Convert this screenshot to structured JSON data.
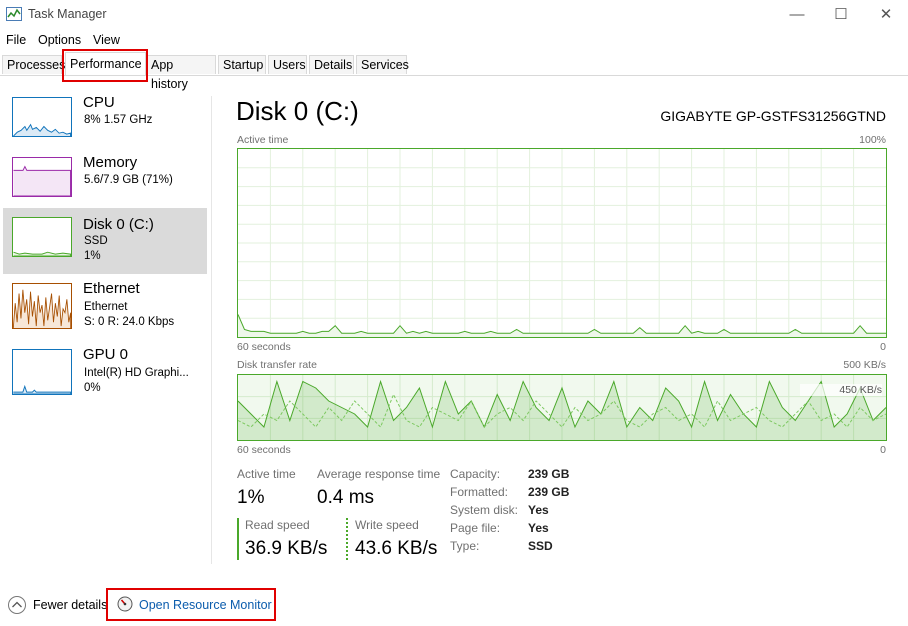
{
  "window": {
    "title": "Task Manager",
    "minimize_glyph": "—",
    "maximize_glyph": "☐",
    "close_glyph": "✕"
  },
  "menu": [
    "File",
    "Options",
    "View"
  ],
  "tabs": [
    {
      "label": "Processes",
      "active": false
    },
    {
      "label": "Performance",
      "active": true
    },
    {
      "label": "App history",
      "active": false
    },
    {
      "label": "Startup",
      "active": false
    },
    {
      "label": "Users",
      "active": false
    },
    {
      "label": "Details",
      "active": false
    },
    {
      "label": "Services",
      "active": false
    }
  ],
  "sidebar": {
    "items": [
      {
        "title": "CPU",
        "line1": "8%  1.57 GHz",
        "line2": "",
        "line3": "",
        "color": "#1174bb"
      },
      {
        "title": "Memory",
        "line1": "5.6/7.9 GB (71%)",
        "line2": "",
        "line3": "",
        "color": "#9a2aa8"
      },
      {
        "title": "Disk 0 (C:)",
        "line1": "SSD",
        "line2": "1%",
        "line3": "",
        "color": "#4aa82a"
      },
      {
        "title": "Ethernet",
        "line1": "Ethernet",
        "line2": "S: 0  R: 24.0 Kbps",
        "line3": "",
        "color": "#a74f01"
      },
      {
        "title": "GPU 0",
        "line1": "Intel(R) HD Graphi...",
        "line2": "0%",
        "line3": "",
        "color": "#1174bb"
      }
    ]
  },
  "main": {
    "title": "Disk 0 (C:)",
    "model": "GIGABYTE GP-GSTFS31256GTND",
    "active_graph": {
      "label": "Active time",
      "max": "100%",
      "time_label": "60 seconds",
      "min": "0",
      "values": [
        12,
        4,
        3,
        3,
        3,
        2,
        2,
        2,
        2,
        2,
        3,
        2,
        2,
        3,
        3,
        6,
        2,
        2,
        2,
        3,
        2,
        2,
        2,
        2,
        2,
        6,
        2,
        3,
        2,
        3,
        2,
        2,
        2,
        2,
        2,
        3,
        2,
        2,
        2,
        3,
        2,
        2,
        2,
        4,
        2,
        2,
        2,
        2,
        2,
        2,
        2,
        2,
        2,
        2,
        2,
        4,
        2,
        2,
        2,
        2,
        2,
        2,
        5,
        2,
        2,
        2,
        2,
        2,
        2,
        6,
        2,
        3,
        2,
        2,
        2,
        4,
        2,
        2,
        2,
        2,
        2,
        2,
        2,
        2,
        2,
        2,
        4,
        2,
        2,
        2,
        2,
        2,
        2,
        2,
        2,
        2,
        6,
        2,
        2,
        2,
        2
      ]
    },
    "transfer_graph": {
      "label": "Disk transfer rate",
      "max": "500 KB/s",
      "inner_max": "450 KB/s",
      "time_label": "60 seconds",
      "min": "0",
      "read_values": [
        60,
        40,
        20,
        90,
        30,
        90,
        80,
        60,
        50,
        40,
        20,
        90,
        30,
        50,
        80,
        20,
        90,
        40,
        60,
        20,
        70,
        30,
        90,
        50,
        30,
        80,
        20,
        60,
        40,
        90,
        20,
        50,
        30,
        80,
        60,
        20,
        90,
        30,
        70,
        40,
        20,
        90,
        50,
        30,
        60,
        90,
        20,
        40,
        80,
        30,
        50
      ],
      "write_values": [
        30,
        20,
        40,
        30,
        60,
        40,
        20,
        50,
        30,
        60,
        40,
        20,
        70,
        30,
        20,
        50,
        40,
        30,
        60,
        20,
        40,
        50,
        30,
        60,
        40,
        20,
        50,
        30,
        40,
        60,
        30,
        20,
        40,
        50,
        30,
        40,
        20,
        60,
        30,
        40,
        50,
        30,
        20,
        40,
        60,
        30,
        40,
        20,
        50,
        30,
        40
      ]
    },
    "stats": {
      "active_time_label": "Active time",
      "active_time_value": "1%",
      "avg_response_label": "Average response time",
      "avg_response_value": "0.4 ms",
      "read_label": "Read speed",
      "read_value": "36.9 KB/s",
      "write_label": "Write speed",
      "write_value": "43.6 KB/s"
    },
    "properties": [
      {
        "label": "Capacity:",
        "value": "239 GB"
      },
      {
        "label": "Formatted:",
        "value": "239 GB"
      },
      {
        "label": "System disk:",
        "value": "Yes"
      },
      {
        "label": "Page file:",
        "value": "Yes"
      },
      {
        "label": "Type:",
        "value": "SSD"
      }
    ]
  },
  "footer": {
    "fewer_details": "Fewer details",
    "open_monitor": "Open Resource Monitor"
  },
  "colors": {
    "disk_green": "#4aa82a",
    "highlight_red": "#e00000",
    "link_blue": "#0b5cad"
  }
}
